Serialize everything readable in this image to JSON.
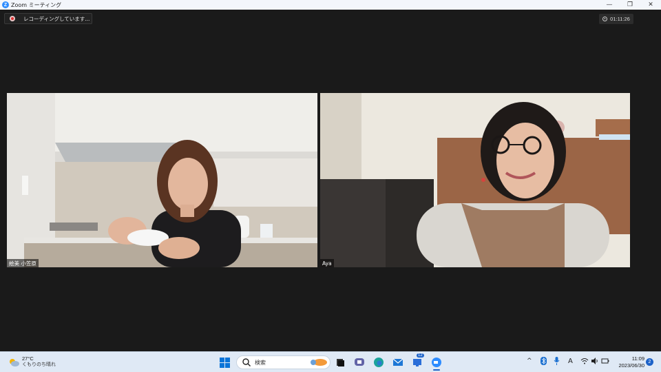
{
  "window": {
    "title": "Zoom ミーティング",
    "logo_letter": "Z",
    "minimize_glyph": "—",
    "maximize_glyph": "❐",
    "close_glyph": "✕"
  },
  "meeting": {
    "recording_text": "レコーディングしています...",
    "elapsed_time": "01:11:26",
    "participants": [
      {
        "name": "絵美 小笠原"
      },
      {
        "name": "Aya"
      }
    ]
  },
  "taskbar": {
    "weather": {
      "temperature": "27°C",
      "condition": "くもりのち晴れ",
      "icon": "partly-cloudy-icon"
    },
    "search_placeholder": "検索",
    "pinned_apps": [
      "task-view-icon",
      "teams-chat-icon",
      "edge-icon",
      "mail-icon",
      "store-icon",
      "zoom-icon"
    ],
    "store_badge": "12",
    "tray": {
      "overflow_glyph": "^",
      "ime_glyph": "A"
    },
    "clock": {
      "time": "11:09",
      "date": "2023/06/30"
    },
    "notification_count": "2"
  },
  "colors": {
    "zoom_blue": "#2d8cff",
    "stage_bg": "#1a1a1a",
    "taskbar_bg": "#dfe9f5",
    "notif_badge": "#1c62c8"
  }
}
